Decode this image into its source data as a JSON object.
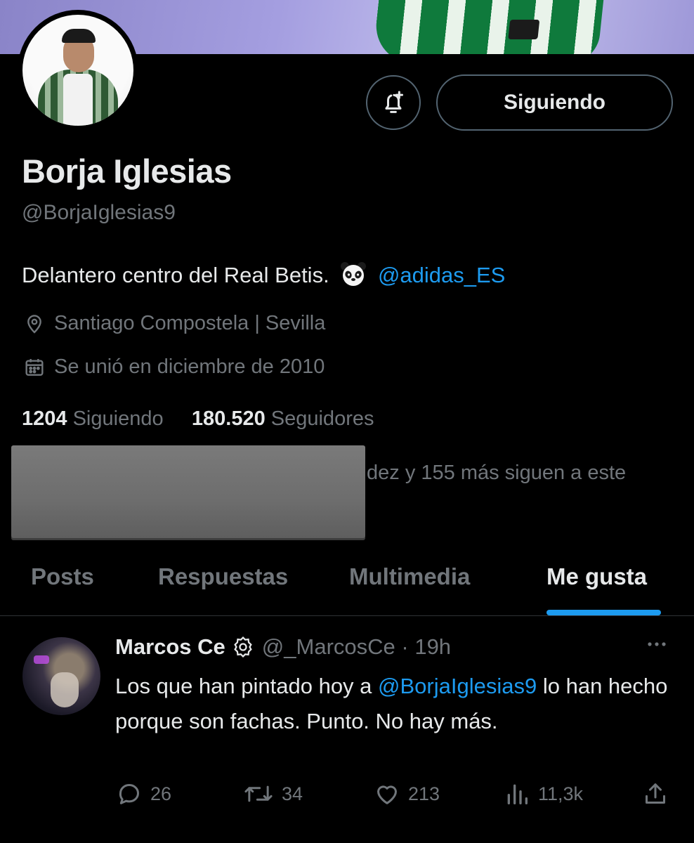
{
  "profile": {
    "name": "Borja Iglesias",
    "handle": "@BorjaIglesias9",
    "bio_text": "Delantero centro del Real Betis.",
    "bio_emoji_icon": "panda-emoji",
    "bio_link": "@adidas_ES",
    "location": "Santiago Compostela | Sevilla",
    "joined": "Se unió en diciembre de 2010",
    "following_count": "1204",
    "following_label": "Siguiendo",
    "followers_count": "180.520",
    "followers_label": "Seguidores",
    "followers_you_know": "dez y 155 más siguen a este"
  },
  "header": {
    "follow_button_label": "Siguiendo",
    "notify_icon": "bell-plus-icon"
  },
  "tabs": [
    {
      "label": "Posts",
      "active": false
    },
    {
      "label": "Respuestas",
      "active": false
    },
    {
      "label": "Multimedia",
      "active": false
    },
    {
      "label": "Me gusta",
      "active": true
    }
  ],
  "post": {
    "author_name": "Marcos Ce",
    "badge_icon": "verified-organization-icon",
    "author_handle": "@_MarcosCe",
    "time": "19h",
    "text_before": "Los que han pintado hoy a ",
    "mention": "@BorjaIglesias9",
    "text_after": " lo han hecho porque son fachas. Punto. No hay más.",
    "replies": "26",
    "reposts": "34",
    "likes": "213",
    "views": "11,3k"
  },
  "colors": {
    "background": "#000000",
    "text": "#e7e9ea",
    "muted": "#71767b",
    "accent": "#1d9bf0",
    "border": "#2f3336"
  }
}
